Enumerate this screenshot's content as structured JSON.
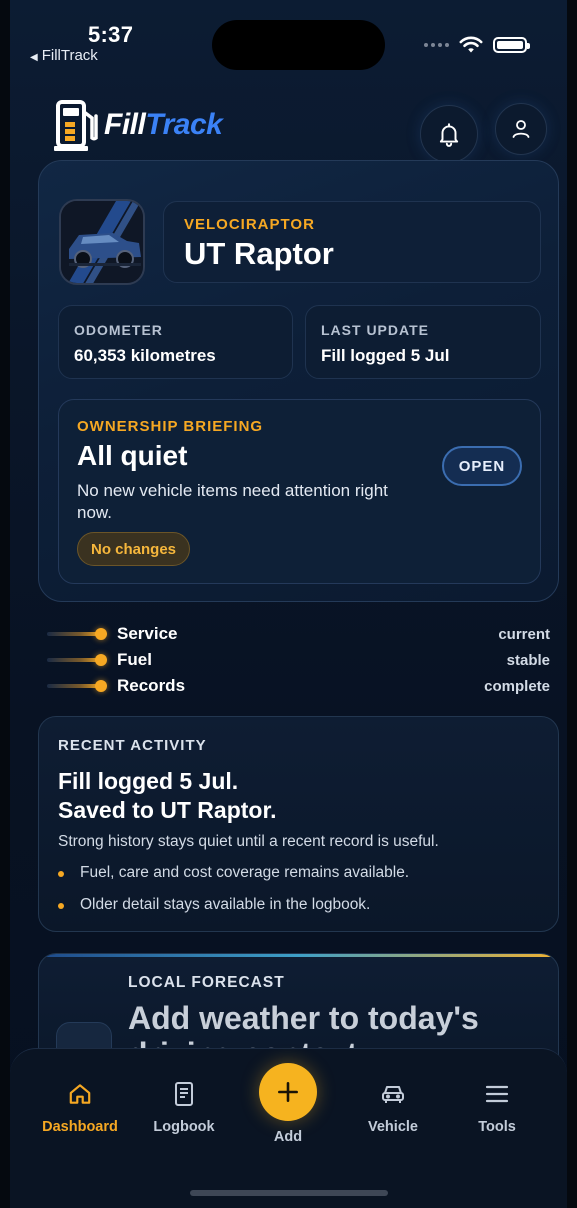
{
  "status_bar": {
    "time": "5:37",
    "back_app": "FillTrack"
  },
  "header": {
    "logo_part1": "Fill",
    "logo_part2": "Track"
  },
  "vehicle": {
    "nickname": "VELOCIRAPTOR",
    "name": "UT Raptor"
  },
  "stats": {
    "odometer_label": "ODOMETER",
    "odometer_value": "60,353 kilometres",
    "last_update_label": "LAST UPDATE",
    "last_update_value": "Fill logged 5 Jul"
  },
  "briefing": {
    "eyebrow": "OWNERSHIP BRIEFING",
    "title": "All quiet",
    "description": "No new vehicle items need attention right now.",
    "badge": "No changes",
    "open_label": "OPEN"
  },
  "status_lines": [
    {
      "name": "Service",
      "value": "current"
    },
    {
      "name": "Fuel",
      "value": "stable"
    },
    {
      "name": "Records",
      "value": "complete"
    }
  ],
  "activity": {
    "eyebrow": "RECENT ACTIVITY",
    "title_line1": "Fill logged 5 Jul.",
    "title_line2": "Saved to UT Raptor.",
    "description": "Strong history stays quiet until a recent record is useful.",
    "bullets": [
      "Fuel, care and cost coverage remains available.",
      "Older detail stays available in the logbook."
    ]
  },
  "forecast": {
    "eyebrow": "LOCAL FORECAST",
    "title": "Add weather to today's driving context"
  },
  "nav": {
    "dashboard": "Dashboard",
    "logbook": "Logbook",
    "add": "Add",
    "vehicle": "Vehicle",
    "tools": "Tools"
  },
  "colors": {
    "accent": "#f6a823",
    "brand_blue": "#3b82f6",
    "background": "#0a1629"
  }
}
